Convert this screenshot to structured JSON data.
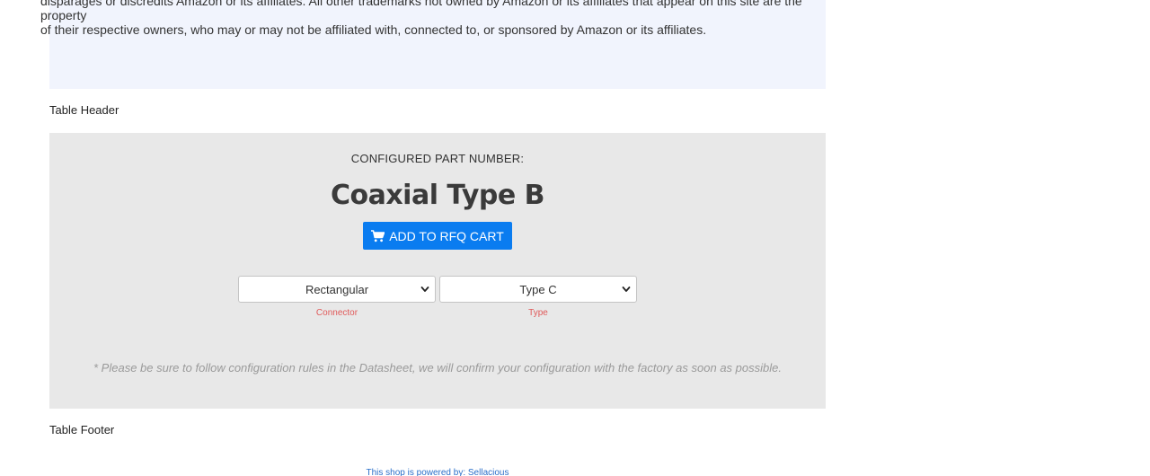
{
  "disclaimer": {
    "line1": "disparages or discredits Amazon or its affiliates. All other trademarks not owned by Amazon or its affiliates that appear on this site are the property",
    "line2": "of their respective owners, who may or may not be affiliated with, connected to, or sponsored by Amazon or its affiliates."
  },
  "labels": {
    "table_header": "Table Header",
    "table_footer": "Table Footer"
  },
  "configurator": {
    "caption": "CONFIGURED PART NUMBER:",
    "part_number": "Coaxial Type B",
    "add_button_label": "ADD TO RFQ CART",
    "add_button_icon": "shopping-cart-icon",
    "connector_select": {
      "value": "Rectangular",
      "hint": "Connector"
    },
    "type_select": {
      "value": "Type C",
      "hint": "Type"
    },
    "note": "* Please be sure to follow configuration rules in the Datasheet, we will confirm your configuration with the factory as soon as possible."
  },
  "footer": {
    "powered_prefix": "This shop is powered by: ",
    "powered_link": "Sellacious"
  },
  "colors": {
    "panel_background": "#e8e8e8",
    "disclaimer_background": "#f1f4fd",
    "button_blue": "#0a7cf0",
    "hint_red": "#e05a5a"
  }
}
